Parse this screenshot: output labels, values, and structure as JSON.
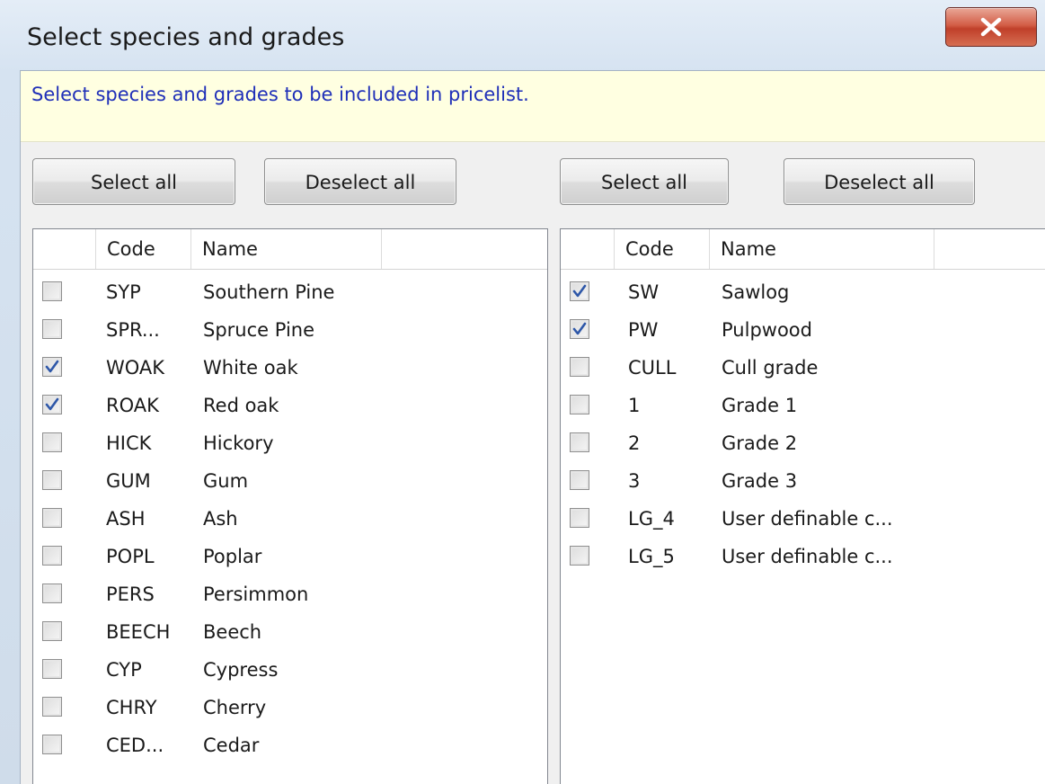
{
  "window": {
    "title": "Select species and grades",
    "close_icon": "close-icon",
    "close_color": "#c7432d"
  },
  "info": {
    "text": "Select species and grades to be included in pricelist."
  },
  "species_panel": {
    "select_all_label": "Select all",
    "deselect_all_label": "Deselect all",
    "columns": [
      "",
      "Code",
      "Name",
      ""
    ],
    "rows": [
      {
        "checked": false,
        "code": "SYP",
        "name": "Southern Pine"
      },
      {
        "checked": false,
        "code": "SPR...",
        "name": "Spruce Pine"
      },
      {
        "checked": true,
        "code": "WOAK",
        "name": "White oak"
      },
      {
        "checked": true,
        "code": "ROAK",
        "name": "Red oak"
      },
      {
        "checked": false,
        "code": "HICK",
        "name": "Hickory"
      },
      {
        "checked": false,
        "code": "GUM",
        "name": "Gum"
      },
      {
        "checked": false,
        "code": "ASH",
        "name": "Ash"
      },
      {
        "checked": false,
        "code": "POPL",
        "name": "Poplar"
      },
      {
        "checked": false,
        "code": "PERS",
        "name": "Persimmon"
      },
      {
        "checked": false,
        "code": "BEECH",
        "name": "Beech"
      },
      {
        "checked": false,
        "code": "CYP",
        "name": "Cypress"
      },
      {
        "checked": false,
        "code": "CHRY",
        "name": "Cherry"
      },
      {
        "checked": false,
        "code": "CED...",
        "name": "Cedar"
      }
    ]
  },
  "grades_panel": {
    "select_all_label": "Select all",
    "deselect_all_label": "Deselect all",
    "columns": [
      "",
      "Code",
      "Name",
      ""
    ],
    "rows": [
      {
        "checked": true,
        "code": "SW",
        "name": "Sawlog"
      },
      {
        "checked": true,
        "code": "PW",
        "name": "Pulpwood"
      },
      {
        "checked": false,
        "code": "CULL",
        "name": "Cull grade"
      },
      {
        "checked": false,
        "code": "1",
        "name": "Grade 1"
      },
      {
        "checked": false,
        "code": "2",
        "name": "Grade 2"
      },
      {
        "checked": false,
        "code": "3",
        "name": "Grade 3"
      },
      {
        "checked": false,
        "code": "LG_4",
        "name": "User definable c..."
      },
      {
        "checked": false,
        "code": "LG_5",
        "name": "User definable c..."
      }
    ]
  },
  "checkmark_color": "#2e57a8"
}
